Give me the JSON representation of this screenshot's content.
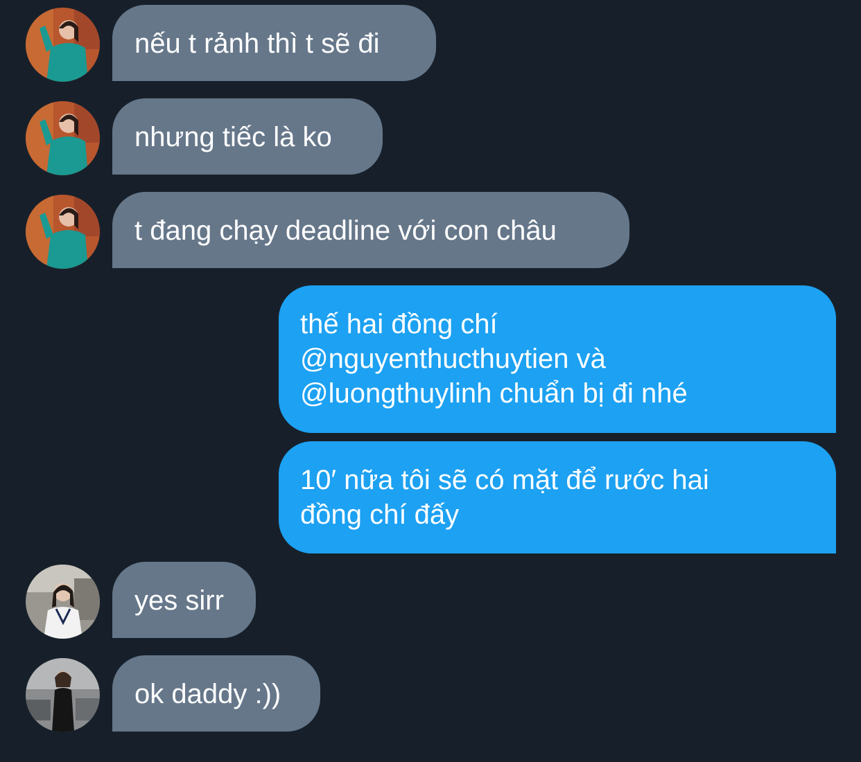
{
  "conversation": {
    "messages": [
      {
        "sender": "them",
        "avatar": "avatar-woman-teal-dress",
        "text": "nếu t rảnh thì t sẽ đi"
      },
      {
        "sender": "them",
        "avatar": "avatar-woman-teal-dress",
        "text": "nhưng tiếc là ko"
      },
      {
        "sender": "them",
        "avatar": "avatar-woman-teal-dress",
        "text": "t đang chạy deadline với con châu"
      },
      {
        "sender": "me",
        "lines": [
          "thế hai đồng chí",
          "@nguyenthucthuytien và",
          "@luongthuylinh chuẩn bị đi nhé"
        ]
      },
      {
        "sender": "me",
        "lines": [
          "10′ nữa tôi sẽ có mặt để rước hai",
          "đồng chí đấy"
        ]
      },
      {
        "sender": "them",
        "avatar": "avatar-woman-white-vest",
        "text": "yes sirr"
      },
      {
        "sender": "them",
        "avatar": "avatar-woman-black-outfit",
        "text": "ok daddy :))"
      }
    ]
  },
  "colors": {
    "background": "#17202a",
    "incoming_bubble": "#66778a",
    "outgoing_bubble": "#1da1f2",
    "text": "#ffffff"
  }
}
